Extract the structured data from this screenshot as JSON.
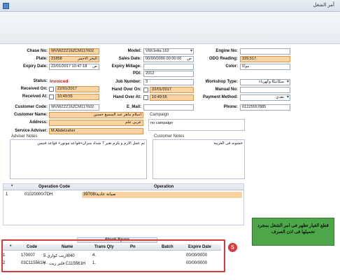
{
  "window": {
    "title": "أمر الشغل"
  },
  "form": {
    "chase_no": {
      "label": "Chase No:",
      "value": "WVWZZZ16ZCM117602"
    },
    "plate": {
      "label": "Plate:",
      "value": "21858",
      "extra": "البحر الاحمر"
    },
    "expiry_date": {
      "label": "Expiry Date:",
      "value": "22/01/2017 10:47:18",
      "suffix": "ص"
    },
    "status": {
      "label": "Status:",
      "value": "Invoiced"
    },
    "received_on": {
      "label": "Received On:",
      "value": "22/01/2017"
    },
    "received_at": {
      "label": "Received At:",
      "value": "10:49:55"
    },
    "customer_code": {
      "label": "Customer Code:",
      "value": "WVWZZZ16ZCM117602"
    },
    "customer_name": {
      "label": "Customer Name:",
      "value": "اسلام ماهر عبد السميع حسين"
    },
    "address": {
      "label": "Address:",
      "value": "عربى علم"
    },
    "service_adviser": {
      "label": "Service Adviser:",
      "value": "M.Abdelzaher"
    },
    "model": {
      "label": "Model:",
      "value": "VW/Jetta 162"
    },
    "sales_date": {
      "label": "Sales Date:",
      "value": "00/00/0000 00:00:00",
      "suffix": "ص"
    },
    "expiry_millage": {
      "label": "Expiry Millage:",
      "value": ""
    },
    "pdi": {
      "label": "PDI:",
      "value": "2012"
    },
    "job_number": {
      "label": "Job Number:",
      "value": "3"
    },
    "hand_over_on": {
      "label": "Hand Over On:",
      "value": "22/01/2017"
    },
    "hand_over_at": {
      "label": "Hand Over At:",
      "value": "10:49:55"
    },
    "email": {
      "label": "E_Mail:",
      "value": ""
    },
    "engine_no": {
      "label": "Engine No:",
      "value": ""
    },
    "odo_reading": {
      "label": "ODO Reading:",
      "value": "339,517."
    },
    "color": {
      "label": "Color:",
      "value": "موكا"
    },
    "workshop_type": {
      "label": "Workshop Type:",
      "value": "ميكانيكا وكهرباء"
    },
    "manual_no": {
      "label": "Manual No:",
      "value": ""
    },
    "payment_method": {
      "label": "Payment Method:",
      "value": "نقدي"
    },
    "phone": {
      "label": "Phone:",
      "value": "01225557885"
    },
    "campaign": {
      "label": "Campaign",
      "value": "no campaign"
    },
    "adviser_notes": {
      "label": "Adviser Notes",
      "value": "تم عمل الازم و يلزم تغير 7 شداد ميزان+فواعد موتور+ فواعد فتيس"
    },
    "customer_notes": {
      "label": "Customer Notes",
      "value": "خشونه فى العريبة"
    }
  },
  "operations": {
    "headers": [
      "*",
      "Operation Code",
      "Operation"
    ],
    "rows": [
      {
        "n": "1",
        "code": "01020000/7DH",
        "op": "صيانة عادية/39708"
      }
    ]
  },
  "spares": {
    "title": "Stock Spare",
    "headers": [
      "*",
      "Code",
      "Name",
      "Trans Qty",
      "Pn",
      "Batch",
      "Expire Date"
    ],
    "rows": [
      {
        "n": "1",
        "code": "170007",
        "name": "زيت كوازي 5W40",
        "qty": "4.",
        "pn": "",
        "batch": "",
        "exp": "00/00/0000"
      },
      {
        "n": "2",
        "code": "03C115561H",
        "name": "فلتر زيت ٢٠ C115561H",
        "qty": "1.",
        "pn": "",
        "batch": "",
        "exp": "00/00/0000"
      }
    ]
  },
  "callout": {
    "text": "قطع الغيار تظهر فى امر الشغل بمجرد تحميلها فى اذن الصرف"
  },
  "badge": {
    "text": "5"
  },
  "colors": {
    "field_orange": "#f9d3a2",
    "status_red": "#d01818",
    "callout_green": "#4ea64a",
    "annotation_red": "#d23b3b"
  }
}
